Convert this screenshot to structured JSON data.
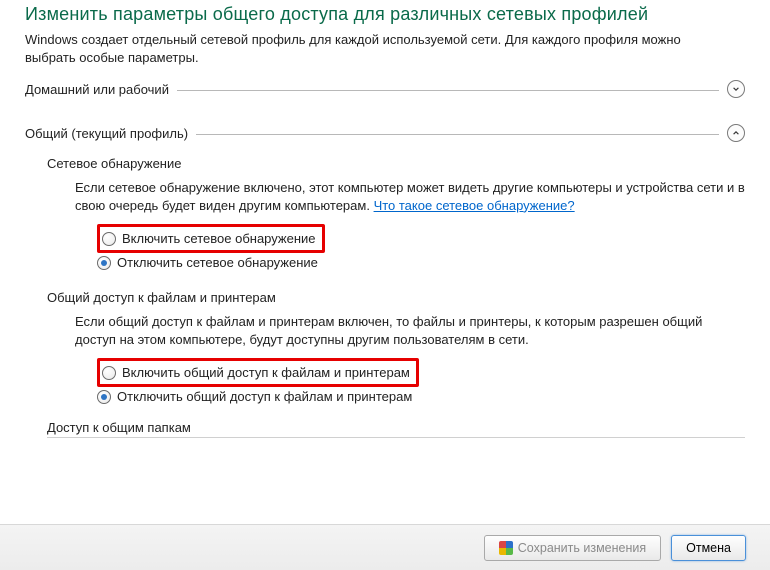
{
  "page": {
    "title": "Изменить параметры общего доступа для различных сетевых профилей",
    "subtitle": "Windows создает отдельный сетевой профиль для каждой используемой сети. Для каждого профиля можно выбрать особые параметры."
  },
  "profiles": {
    "home": {
      "label": "Домашний или рабочий",
      "expanded": false
    },
    "public": {
      "label": "Общий (текущий профиль)",
      "expanded": true
    }
  },
  "network_discovery": {
    "heading": "Сетевое обнаружение",
    "desc_pre": "Если сетевое обнаружение включено, этот компьютер может видеть другие компьютеры и устройства сети и в свою очередь будет виден другим компьютерам. ",
    "link": "Что такое сетевое обнаружение?",
    "radio_on": "Включить сетевое обнаружение",
    "radio_off": "Отключить сетевое обнаружение"
  },
  "file_printer": {
    "heading": "Общий доступ к файлам и принтерам",
    "desc": "Если общий доступ к файлам и принтерам включен, то файлы и принтеры, к которым разрешен общий доступ на этом компьютере, будут доступны другим пользователям в сети.",
    "radio_on": "Включить общий доступ к файлам и принтерам",
    "radio_off": "Отключить общий доступ к файлам и принтерам"
  },
  "public_folders": {
    "heading": "Доступ к общим папкам"
  },
  "footer": {
    "save": "Сохранить изменения",
    "cancel": "Отмена"
  }
}
